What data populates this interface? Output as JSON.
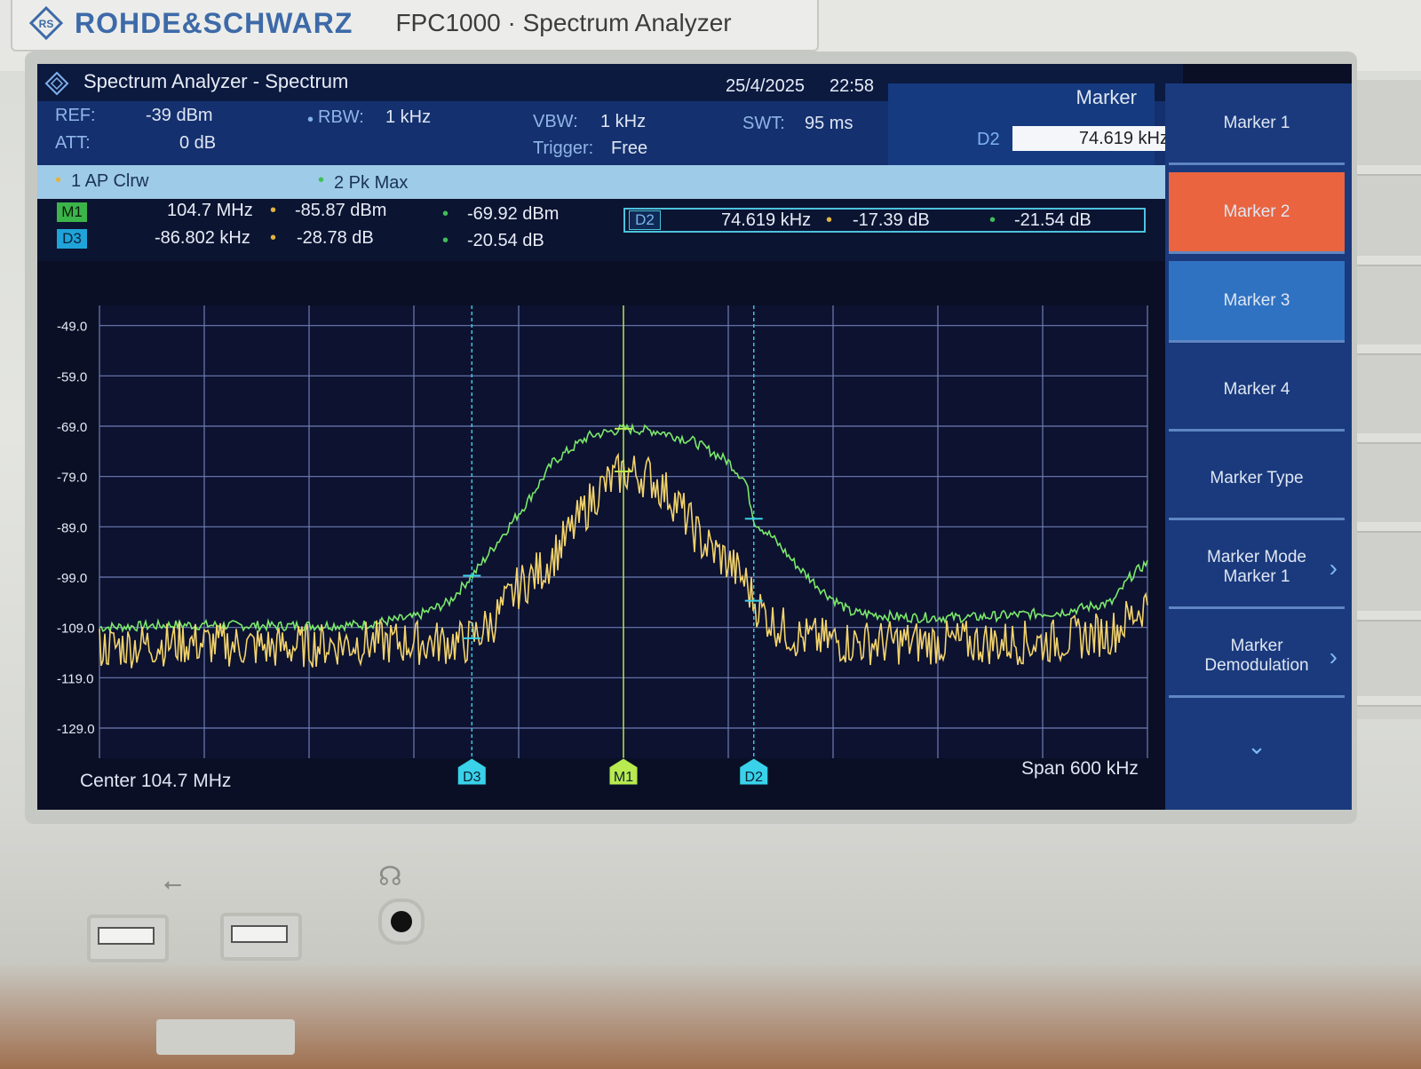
{
  "brand": {
    "name": "ROHDE&SCHWARZ",
    "model": "FPC1000 · Spectrum Analyzer"
  },
  "titlebar": {
    "title": "Spectrum Analyzer - Spectrum",
    "date": "25/4/2025",
    "time": "22:58"
  },
  "params": {
    "ref_label": "REF:",
    "ref_value": "-39 dBm",
    "att_label": "ATT:",
    "att_value": "0 dB",
    "rbw_label": "RBW:",
    "rbw_value": "1 kHz",
    "vbw_label": "VBW:",
    "vbw_value": "1 kHz",
    "trigger_label": "Trigger:",
    "trigger_value": "Free",
    "swt_label": "SWT:",
    "swt_value": "95 ms"
  },
  "marker_panel": {
    "title": "Marker",
    "input_label": "D2",
    "input_value": "74.619 kHz"
  },
  "traces": {
    "t1": "1 AP Clrw",
    "t2": "2 Pk Max"
  },
  "readouts": {
    "m1": {
      "tag": "M1",
      "x": "104.7 MHz",
      "v1": "-85.87 dBm",
      "v2": "-69.92 dBm"
    },
    "d3": {
      "tag": "D3",
      "x": "-86.802 kHz",
      "v1": "-28.78 dB",
      "v2": "-20.54 dB"
    },
    "d2": {
      "tag": "D2",
      "x": "74.619 kHz",
      "v1": "-17.39 dB",
      "v2": "-21.54 dB"
    }
  },
  "chart_data": {
    "type": "line",
    "title": "",
    "xlabel": "",
    "ylabel": "",
    "center": "Center 104.7 MHz",
    "span": "Span 600 kHz",
    "x_range_khz": [
      -300,
      300
    ],
    "ylim": [
      -135,
      -45
    ],
    "y_ticks": [
      "-49.0",
      "-59.0",
      "-69.0",
      "-79.0",
      "-89.0",
      "-99.0",
      "-109.0",
      "-119.0",
      "-129.0"
    ],
    "grid": true,
    "series": [
      {
        "name": "2 Pk Max",
        "color": "#7be86a",
        "x": [
          -300,
          -255,
          -195,
          -150,
          -120,
          -100,
          -85,
          -70,
          -55,
          -40,
          -20,
          0,
          20,
          40,
          60,
          70,
          75,
          85,
          100,
          115,
          130,
          160,
          200,
          250,
          280,
          290,
          300
        ],
        "y": [
          -109,
          -108.5,
          -108.7,
          -108.5,
          -107,
          -104,
          -98,
          -91,
          -84,
          -76,
          -71,
          -69.5,
          -70,
          -72,
          -76,
          -80,
          -88,
          -91,
          -97,
          -102,
          -106,
          -107,
          -107,
          -106,
          -104,
          -99,
          -96
        ]
      },
      {
        "name": "1 AP Clrw",
        "color": "#f3d36b",
        "x": [
          -300,
          -250,
          -200,
          -150,
          -110,
          -90,
          -75,
          -60,
          -45,
          -30,
          -15,
          0,
          15,
          30,
          45,
          60,
          70,
          75,
          85,
          100,
          130,
          180,
          240,
          280,
          300
        ],
        "y": [
          -113,
          -112,
          -113,
          -112,
          -112,
          -112,
          -108,
          -101,
          -97,
          -90,
          -82,
          -78,
          -79,
          -84,
          -92,
          -96,
          -100,
          -104,
          -108,
          -111,
          -112,
          -112,
          -112,
          -110,
          -104
        ]
      }
    ],
    "markers": [
      {
        "name": "D3",
        "x_khz": -86.802,
        "color": "#39d2ea"
      },
      {
        "name": "M1",
        "x_khz": 0,
        "color": "#b9ea4f"
      },
      {
        "name": "D2",
        "x_khz": 74.619,
        "color": "#39d2ea"
      }
    ]
  },
  "softkeys": [
    "Marker 1",
    "Marker 2",
    "Marker 3",
    "Marker 4",
    "Marker Type",
    "Marker Mode\nMarker 1",
    "Marker\nDemodulation"
  ]
}
